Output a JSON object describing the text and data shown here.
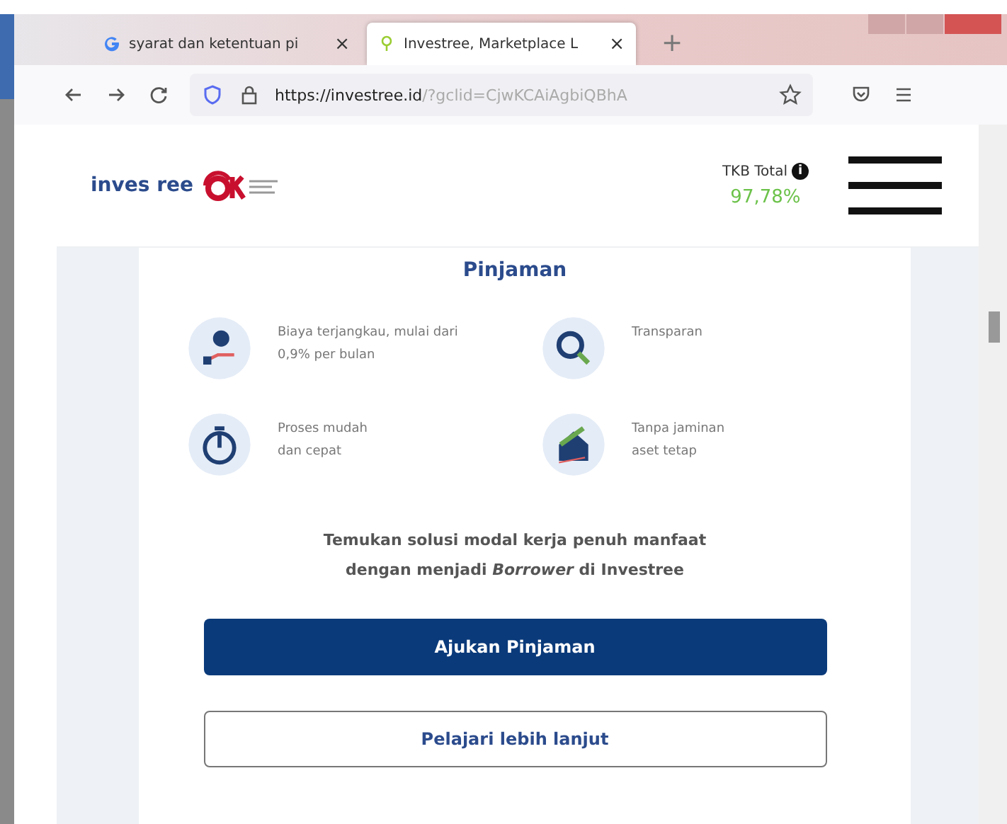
{
  "browser": {
    "tabs": [
      {
        "title": "syarat dan ketentuan pi",
        "close": "×",
        "selected": false
      },
      {
        "title": "Investree, Marketplace L",
        "close": "×",
        "selected": true
      }
    ],
    "new_tab": "+",
    "url_host": "https://investree.id",
    "url_rest": "/?gclid=CjwKCAiAgbiQBhA"
  },
  "header": {
    "logo": "inves ree",
    "tkb_label": "TKB Total",
    "tkb_info": "i",
    "tkb_value": "97,78%"
  },
  "section": {
    "title": "Pinjaman",
    "features": [
      {
        "kind": "money",
        "lines": [
          "Biaya terjangkau, mulai dari",
          "0,9% per bulan"
        ]
      },
      {
        "kind": "search",
        "lines": [
          "Transparan"
        ]
      },
      {
        "kind": "timer",
        "lines": [
          "Proses mudah",
          "dan cepat"
        ]
      },
      {
        "kind": "house",
        "lines": [
          "Tanpa jaminan",
          "aset tetap"
        ]
      }
    ],
    "tagline": [
      "Temukan solusi modal kerja penuh manfaat",
      "dengan menjadi *Borrower* di Investree"
    ],
    "buttons": [
      {
        "label": "Ajukan Pinjaman",
        "kind": "primary"
      },
      {
        "label": "Pelajari lebih lanjut",
        "kind": "outline"
      }
    ]
  }
}
